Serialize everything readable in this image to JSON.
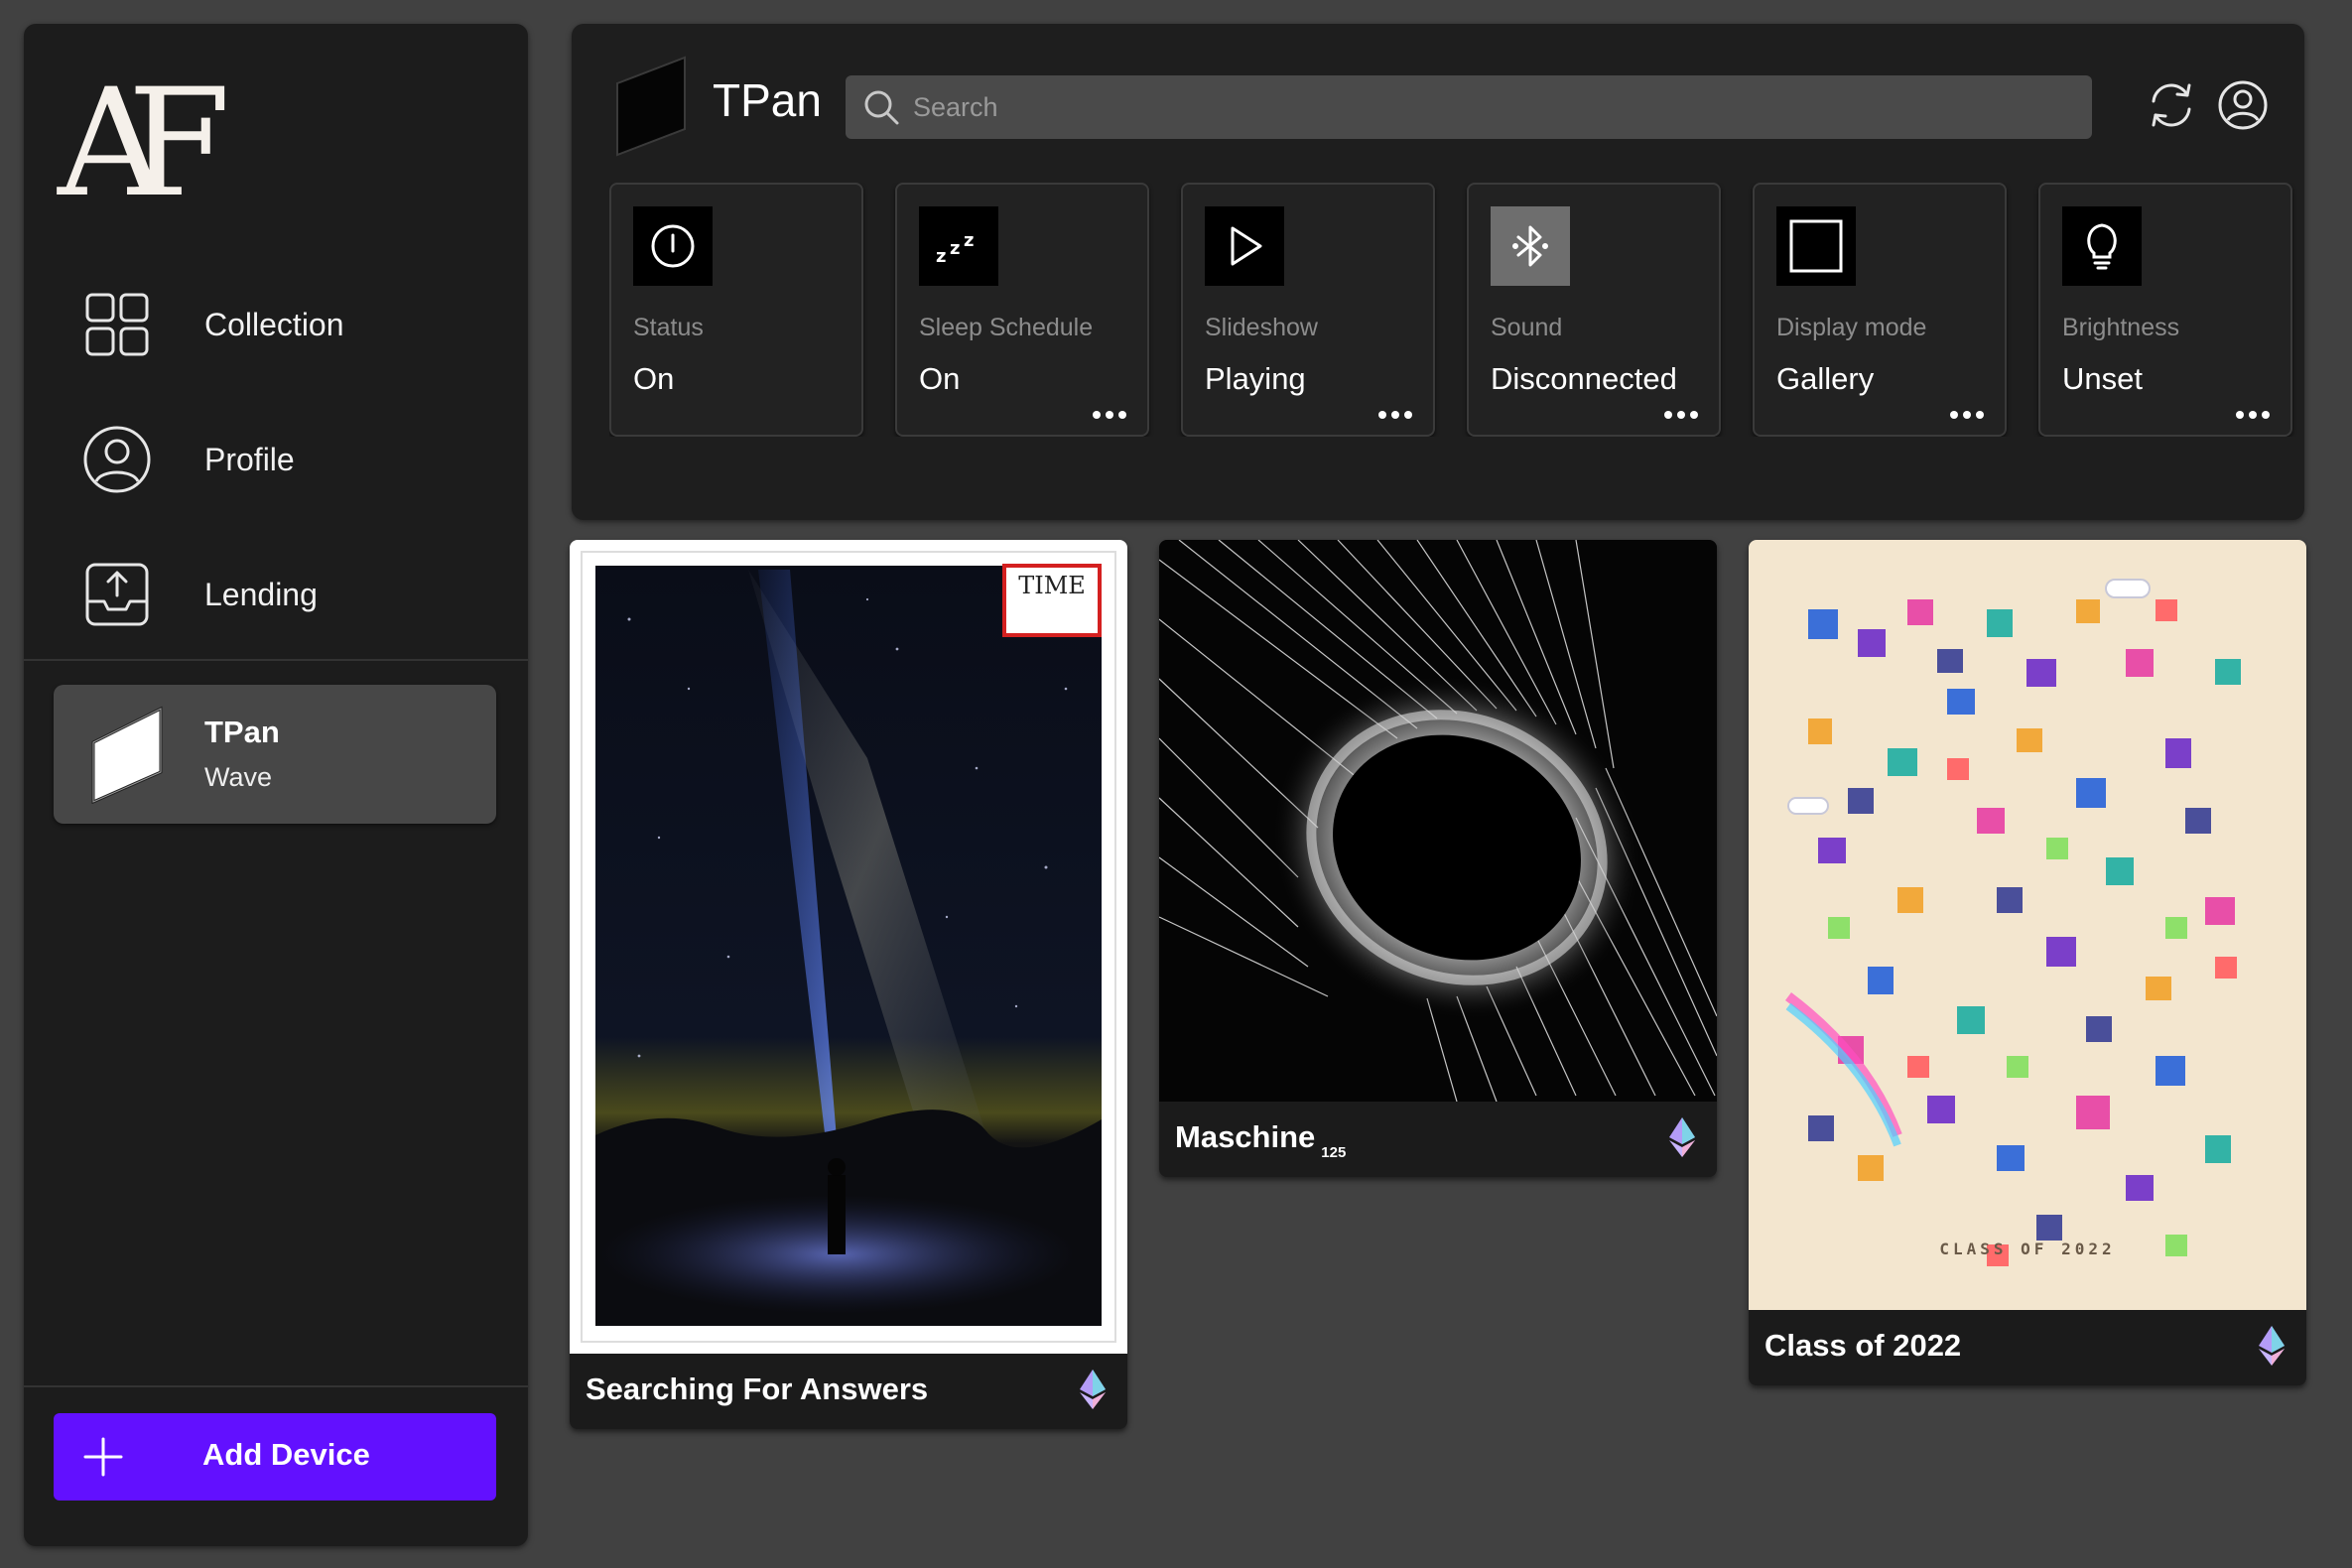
{
  "sidebar": {
    "logo_text": "AF",
    "nav": [
      {
        "label": "Collection",
        "icon": "grid-icon"
      },
      {
        "label": "Profile",
        "icon": "user-circle-icon"
      },
      {
        "label": "Lending",
        "icon": "upload-tray-icon"
      }
    ],
    "device": {
      "name": "TPan",
      "type": "Wave"
    },
    "add_device_label": "Add Device"
  },
  "header": {
    "device_name": "TPan",
    "search_placeholder": "Search"
  },
  "tiles": [
    {
      "label": "Status",
      "value": "On",
      "icon": "power-icon",
      "has_menu": false
    },
    {
      "label": "Sleep Schedule",
      "value": "On",
      "icon": "sleep-zzz-icon",
      "has_menu": true
    },
    {
      "label": "Slideshow",
      "value": "Playing",
      "icon": "play-icon",
      "has_menu": true
    },
    {
      "label": "Sound",
      "value": "Disconnected",
      "icon": "bluetooth-icon",
      "has_menu": true
    },
    {
      "label": "Display mode",
      "value": "Gallery",
      "icon": "square-icon",
      "has_menu": true
    },
    {
      "label": "Brightness",
      "value": "Unset",
      "icon": "lightbulb-icon",
      "has_menu": true
    }
  ],
  "artworks": [
    {
      "title": "Searching For Answers",
      "edition": "",
      "cover_text": "TIME",
      "chain_icon": "ethereum-icon"
    },
    {
      "title": "Maschine",
      "edition": "125",
      "chain_icon": "ethereum-icon"
    },
    {
      "title": "Class of 2022",
      "edition": "",
      "poster_text": "CLASS OF 2022",
      "chain_icon": "ethereum-icon"
    }
  ],
  "colors": {
    "background": "#414141",
    "panel": "#1e1e1e",
    "accent": "#6210ff",
    "muted_text": "#8c8c8c"
  }
}
